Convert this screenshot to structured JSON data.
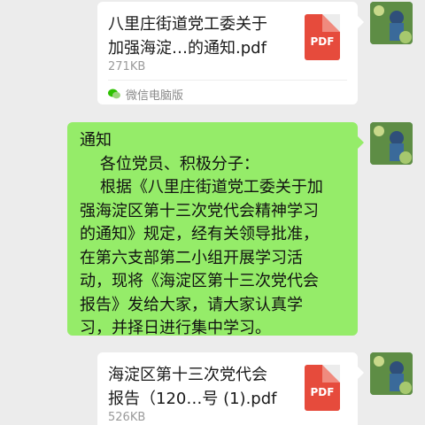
{
  "messages": {
    "file1": {
      "name_line1": "八里庄街道党工委关于",
      "name_line2": "加强海淀…的通知.pdf",
      "size": "271KB",
      "file_type": "PDF",
      "source": "微信电脑版"
    },
    "text": {
      "lines": [
        "通知",
        "    各位党员、积极分子：",
        "    根据《八里庄街道党工委关于加",
        "强海淀区第十三次党代会精神学习",
        "的通知》规定，经有关领导批准，",
        "在第六支部第二小组开展学习活",
        "动，现将《海淀区第十三次党代会",
        "报告》发给大家，请大家认真学",
        "习，并择日进行集中学习。"
      ]
    },
    "file2": {
      "name_line1": "海淀区第十三次党代会",
      "name_line2": "报告（120…号 (1).pdf",
      "size": "526KB",
      "file_type": "PDF"
    }
  },
  "colors": {
    "chat_background": "#ececec",
    "sent_bubble": "#95ec69",
    "pdf_icon": "#e64b3c",
    "wechat_green": "#2dc100"
  }
}
